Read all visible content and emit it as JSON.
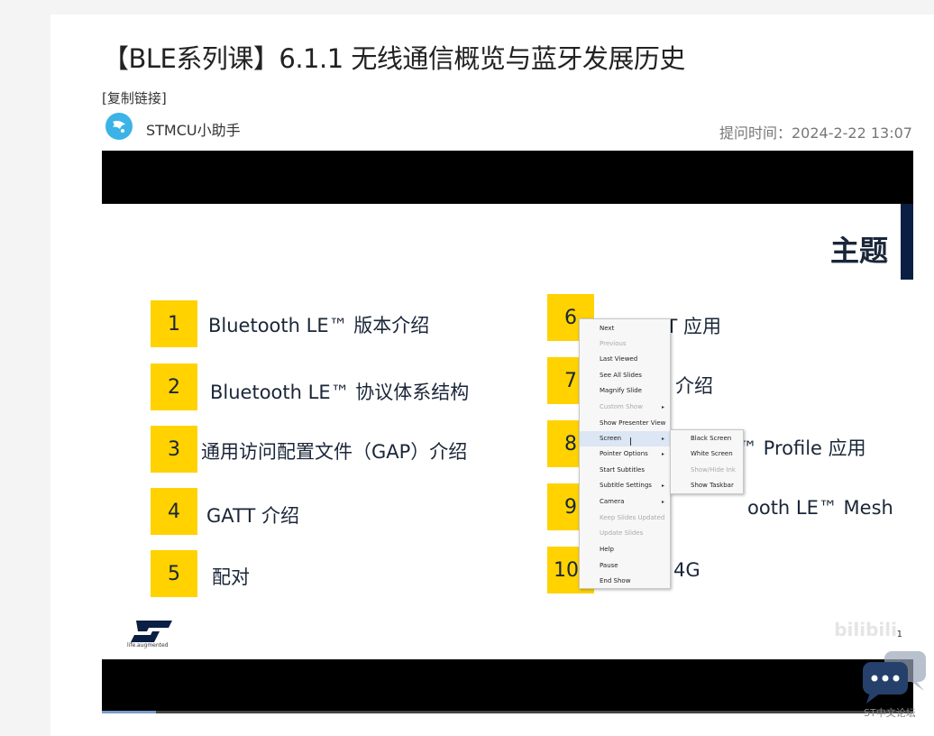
{
  "header": {
    "title": "【BLE系列课】6.1.1 无线通信概览与蓝牙发展历史",
    "copy_link": "[复制链接]",
    "author": "STMCU小助手",
    "time": "提问时间：2024-2-22 13:07"
  },
  "slide": {
    "title": "主题",
    "left_items": [
      {
        "num": "1",
        "text": "Bluetooth LE™ 版本介绍"
      },
      {
        "num": "2",
        "text": "Bluetooth LE™ 协议体系结构"
      },
      {
        "num": "3",
        "text": "通用访问配置文件（GAP）介绍"
      },
      {
        "num": "4",
        "text": "GATT 介绍"
      },
      {
        "num": "5",
        "text": "配对"
      }
    ],
    "right_items": [
      {
        "num": "6",
        "text": "GATT 应用"
      },
      {
        "num": "7",
        "text": "介绍"
      },
      {
        "num": "8",
        "text": "™ Profile 应用"
      },
      {
        "num": "9",
        "text": "ooth LE™ Mesh"
      },
      {
        "num": "10",
        "text": "4G"
      }
    ],
    "logo_text": "life.augmented",
    "page_number": "1",
    "watermark": "bilibili"
  },
  "context_menu": {
    "items": [
      {
        "label": "Next",
        "disabled": false,
        "submenu": false
      },
      {
        "label": "Previous",
        "disabled": true,
        "submenu": false
      },
      {
        "label": "Last Viewed",
        "disabled": false,
        "submenu": false
      },
      {
        "label": "See All Slides",
        "disabled": false,
        "submenu": false
      },
      {
        "label": "Magnify Slide",
        "disabled": false,
        "submenu": false
      },
      {
        "label": "Custom Show",
        "disabled": true,
        "submenu": true
      },
      {
        "label": "Show Presenter View",
        "disabled": false,
        "submenu": false
      },
      {
        "label": "Screen",
        "disabled": false,
        "submenu": true,
        "highlight": true
      },
      {
        "label": "Pointer Options",
        "disabled": false,
        "submenu": true
      },
      {
        "label": "Start Subtitles",
        "disabled": false,
        "submenu": false
      },
      {
        "label": "Subtitle Settings",
        "disabled": false,
        "submenu": true
      },
      {
        "label": "Camera",
        "disabled": false,
        "submenu": true
      },
      {
        "label": "Keep Slides Updated",
        "disabled": true,
        "submenu": false
      },
      {
        "label": "Update Slides",
        "disabled": true,
        "submenu": false
      },
      {
        "label": "Help",
        "disabled": false,
        "submenu": false
      },
      {
        "label": "Pause",
        "disabled": false,
        "submenu": false
      },
      {
        "label": "End Show",
        "disabled": false,
        "submenu": false
      }
    ]
  },
  "screen_submenu": {
    "items": [
      {
        "label": "Black Screen",
        "disabled": false
      },
      {
        "label": "White Screen",
        "disabled": false
      },
      {
        "label": "Show/Hide Ink",
        "disabled": true
      },
      {
        "label": "Show Taskbar",
        "disabled": false
      }
    ]
  },
  "chat": {
    "label": "ST中文论坛"
  },
  "colors": {
    "accent_yellow": "#ffd200",
    "navy": "#0b1e44",
    "avatar": "#3bb3e6",
    "chat": "#24406b"
  }
}
